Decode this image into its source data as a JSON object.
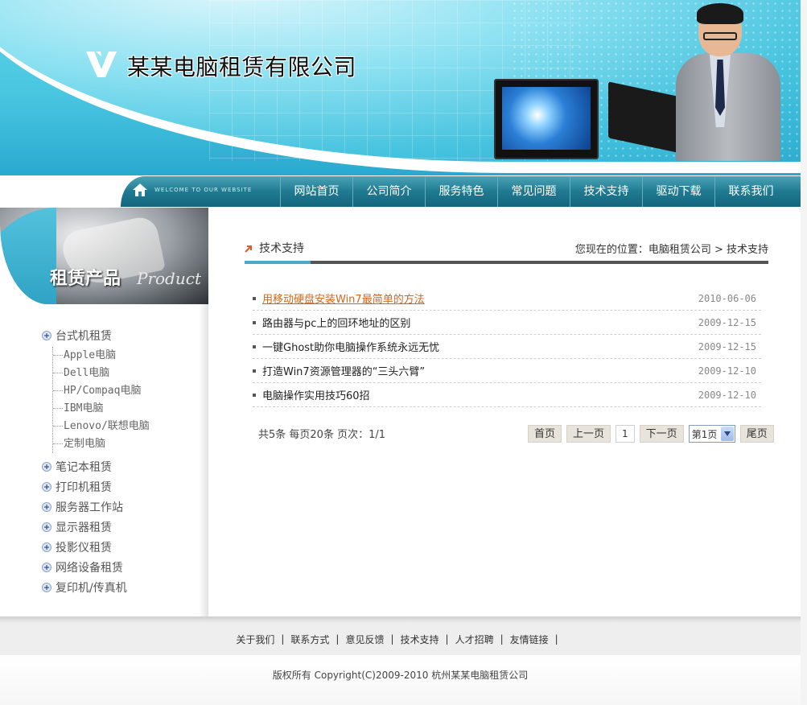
{
  "header": {
    "company_name": "某某电脑租赁有限公司"
  },
  "nav": {
    "welcome": "WELCOME TO OUR WEBSITE",
    "items": [
      "网站首页",
      "公司简介",
      "服务特色",
      "常见问题",
      "技术支持",
      "驱动下载",
      "联系我们"
    ]
  },
  "sidebar": {
    "banner_cn": "租赁产品",
    "banner_en": "Product",
    "categories": [
      {
        "label": "台式机租赁",
        "children": [
          "Apple电脑",
          "Dell电脑",
          "HP/Compaq电脑",
          "IBM电脑",
          "Lenovo/联想电脑",
          "定制电脑"
        ]
      },
      {
        "label": "笔记本租赁"
      },
      {
        "label": "打印机租赁"
      },
      {
        "label": "服务器工作站"
      },
      {
        "label": "显示器租赁"
      },
      {
        "label": "投影仪租赁"
      },
      {
        "label": "网络设备租赁"
      },
      {
        "label": "复印机/传真机"
      }
    ]
  },
  "main": {
    "section_title": "技术支持",
    "location": "您现在的位置：电脑租赁公司 > 技术支持",
    "articles": [
      {
        "title": "用移动硬盘安装Win7最简单的方法",
        "date": "2010-06-06"
      },
      {
        "title": "路由器与pc上的回环地址的区别",
        "date": "2009-12-15"
      },
      {
        "title": "一键Ghost助你电脑操作系统永远无忧",
        "date": "2009-12-15"
      },
      {
        "title": "打造Win7资源管理器的“三头六臂”",
        "date": "2009-12-10"
      },
      {
        "title": "电脑操作实用技巧60招",
        "date": "2009-12-10"
      }
    ],
    "pager": {
      "info": "共5条  每页20条  页次：1/1",
      "first": "首页",
      "prev": "上一页",
      "current": "1",
      "next": "下一页",
      "select_value": "第1页",
      "last": "尾页"
    }
  },
  "footer": {
    "links": [
      "关于我们",
      "联系方式",
      "意见反馈",
      "技术支持",
      "人才招聘",
      "友情链接"
    ],
    "separator": "|",
    "copyright": "版权所有  Copyright(C)2009-2010 杭州某某电脑租赁公司"
  }
}
